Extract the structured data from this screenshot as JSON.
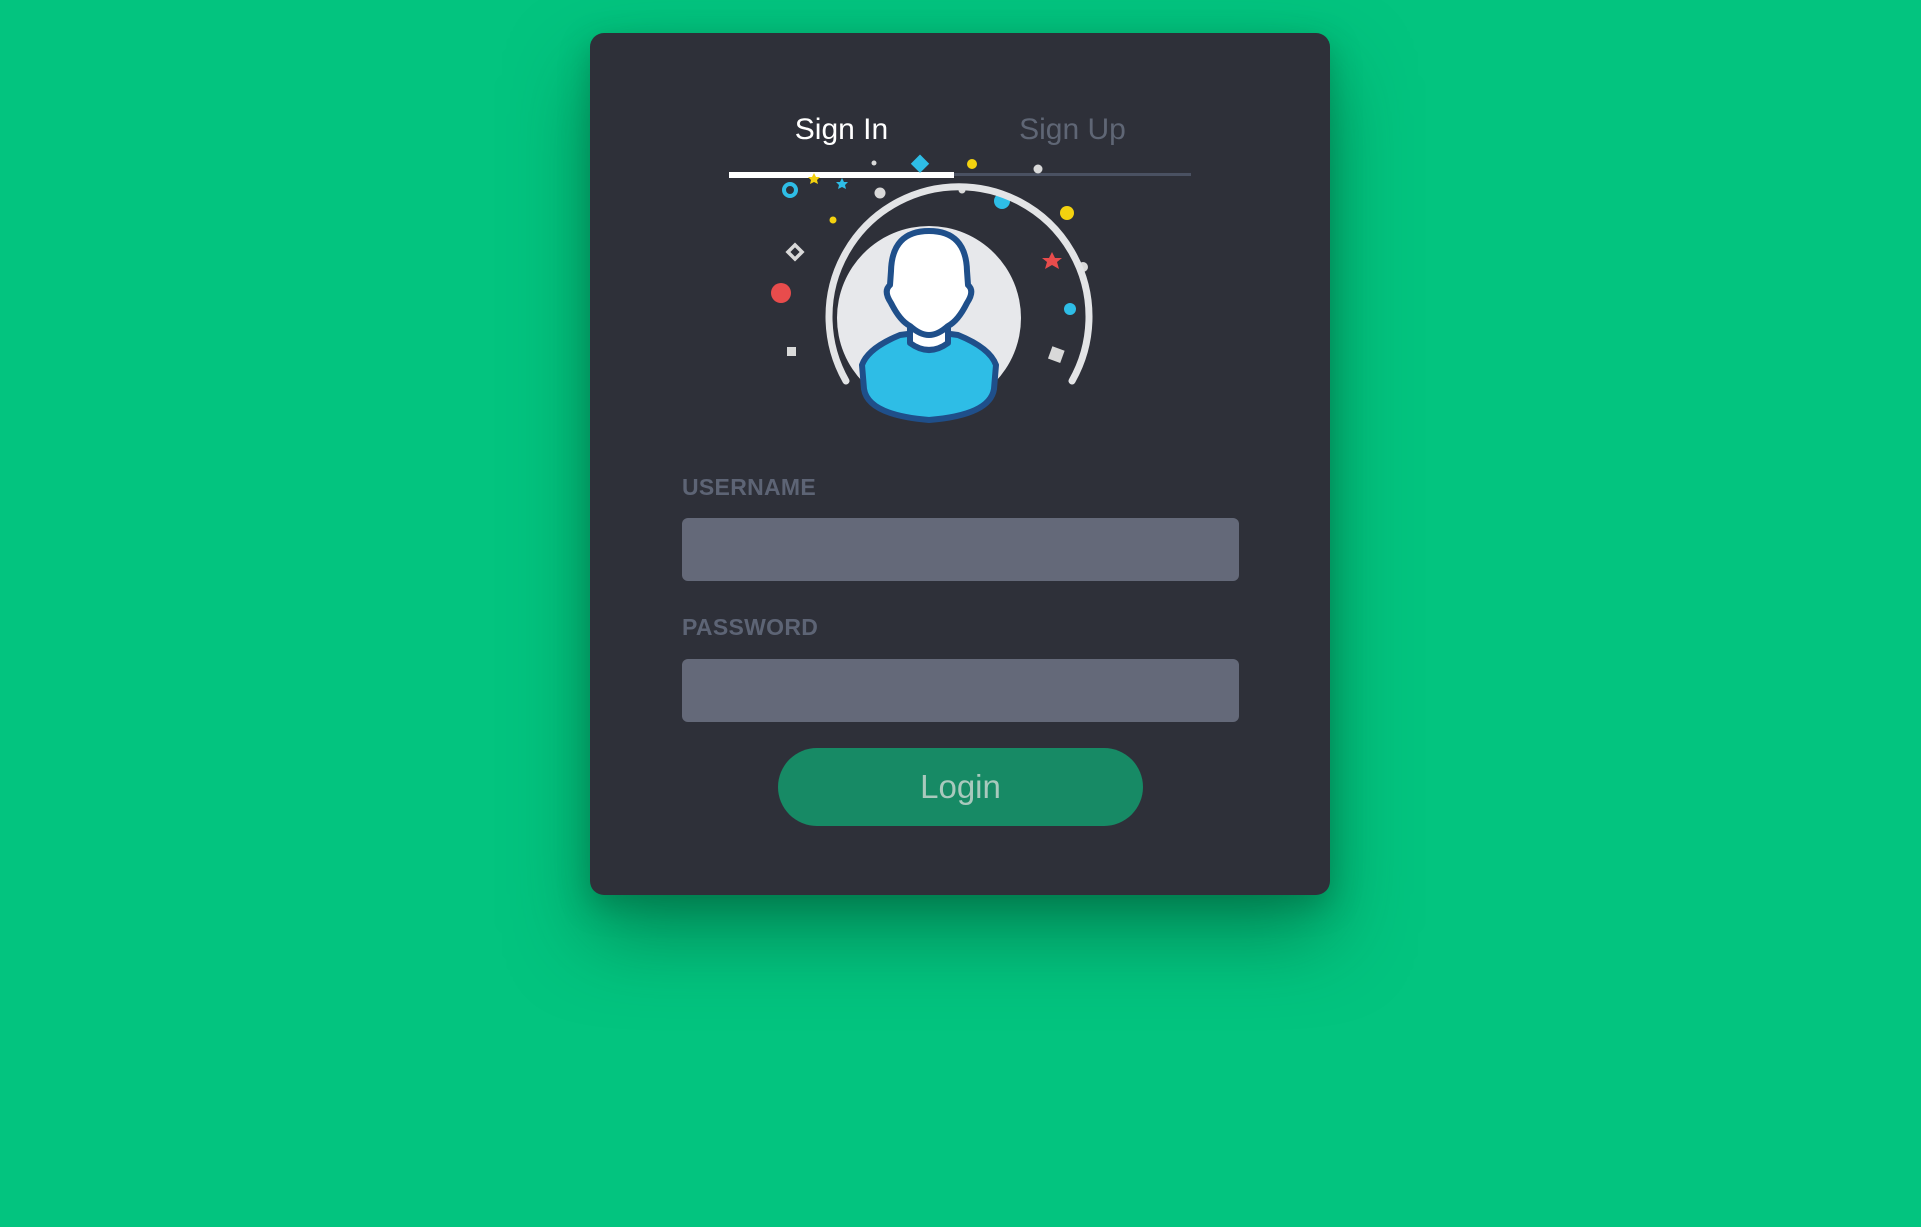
{
  "tabs": {
    "signin_label": "Sign In",
    "signup_label": "Sign Up",
    "active": "signin"
  },
  "form": {
    "username_label": "USERNAME",
    "username_value": "",
    "password_label": "PASSWORD",
    "password_value": "",
    "login_label": "Login"
  },
  "avatar": {
    "icon": "user-avatar-icon"
  },
  "colors": {
    "background": "#03c47f",
    "card": "#2e3039",
    "input": "#646979",
    "button": "#178a65",
    "label": "#5d6475",
    "avatar_shirt": "#2ebde6",
    "avatar_outline": "#1f4f8a"
  }
}
